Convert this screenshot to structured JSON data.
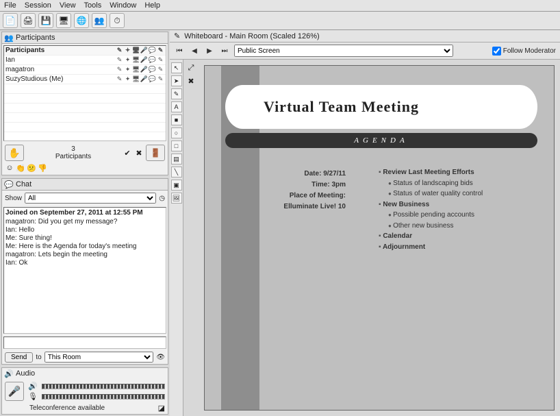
{
  "menu": [
    "File",
    "Session",
    "View",
    "Tools",
    "Window",
    "Help"
  ],
  "participants": {
    "title": "Participants",
    "col_header": "Participants",
    "rows": [
      "Ian",
      "magatron",
      "SuzyStudious (Me)"
    ],
    "count_num": "3",
    "count_label": "Participants"
  },
  "chat": {
    "title": "Chat",
    "show_label": "Show",
    "show_value": "All",
    "joined": "Joined on September 27, 2011 at 12:55 PM",
    "lines": [
      "magatron: Did you get my message?",
      "Ian: Hello",
      "Me: Sure thing!",
      "Me: Here is the Agenda for today's meeting",
      "magatron: Lets begin the meeting",
      "Ian: Ok"
    ],
    "send_label": "Send",
    "to_label": "to",
    "room_value": "This Room"
  },
  "audio": {
    "title": "Audio",
    "status": "Teleconference available"
  },
  "whiteboard": {
    "title": "Whiteboard - Main Room (Scaled 126%)",
    "screen_value": "Public Screen",
    "follow_label": "Follow Moderator"
  },
  "slide": {
    "title": "Virtual Team Meeting",
    "agenda_word": "AGENDA",
    "date_label": "Date:",
    "date_value": "9/27/11",
    "time_label": "Time:",
    "time_value": "3pm",
    "place_label": "Place of Meeting:",
    "place_value": "Elluminate Live! 10",
    "items": {
      "a": "Review Last Meeting Efforts",
      "a1": "Status of landscaping bids",
      "a2": "Status of water quality control",
      "b": "New Business",
      "b1": "Possible pending accounts",
      "b2": "Other new business",
      "c": "Calendar",
      "d": "Adjournment"
    }
  }
}
